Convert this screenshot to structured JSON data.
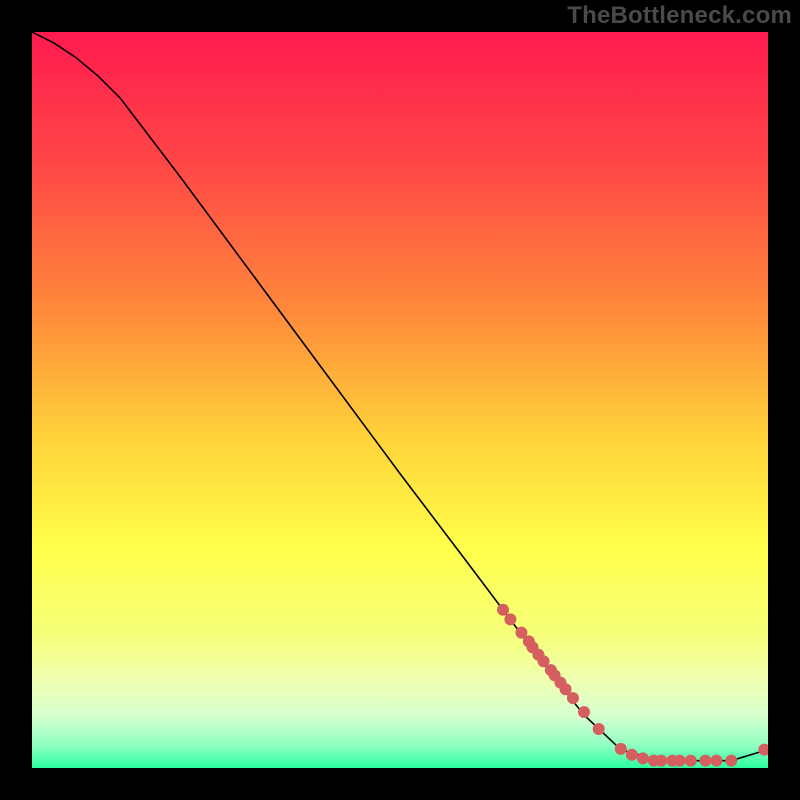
{
  "watermark": "TheBottleneck.com",
  "chart_data": {
    "type": "line",
    "title": "",
    "xlabel": "",
    "ylabel": "",
    "xlim": [
      0,
      100
    ],
    "ylim": [
      0,
      100
    ],
    "grid": false,
    "legend": false,
    "gradient_stops": [
      {
        "pos": 0.0,
        "color": "#ff1a4f"
      },
      {
        "pos": 0.18,
        "color": "#ff4747"
      },
      {
        "pos": 0.38,
        "color": "#ff8a3a"
      },
      {
        "pos": 0.55,
        "color": "#ffd23a"
      },
      {
        "pos": 0.7,
        "color": "#ffff4a"
      },
      {
        "pos": 0.82,
        "color": "#f6ff7a"
      },
      {
        "pos": 0.88,
        "color": "#efffb0"
      },
      {
        "pos": 0.93,
        "color": "#d6ffd0"
      },
      {
        "pos": 0.97,
        "color": "#8dffc0"
      },
      {
        "pos": 1.0,
        "color": "#2bff9f"
      }
    ],
    "series": [
      {
        "name": "curve",
        "type": "line",
        "color": "#000000",
        "x": [
          0,
          3,
          6,
          9,
          12,
          20,
          30,
          40,
          50,
          60,
          70,
          75,
          80,
          85,
          90,
          95,
          100
        ],
        "y": [
          100,
          98.5,
          96.5,
          94,
          91,
          80.5,
          67,
          53.5,
          40,
          26.8,
          13.5,
          7.2,
          2.5,
          1,
          1,
          1,
          2.5
        ]
      },
      {
        "name": "markers",
        "type": "scatter",
        "color": "#d55f5f",
        "radius": 6,
        "x": [
          64,
          65,
          66.5,
          67.5,
          68,
          68.8,
          69.5,
          70.5,
          71,
          71.8,
          72.5,
          73.5,
          75,
          77,
          80,
          81.5,
          83,
          84.5,
          85.5,
          87,
          88,
          89.5,
          91.5,
          93,
          95,
          99.5
        ],
        "y": [
          21.5,
          20.2,
          18.4,
          17.2,
          16.4,
          15.4,
          14.5,
          13.3,
          12.6,
          11.6,
          10.7,
          9.5,
          7.6,
          5.3,
          2.6,
          1.8,
          1.3,
          1.0,
          1.0,
          1.0,
          1.0,
          1.0,
          1.0,
          1.0,
          1.0,
          2.5
        ]
      }
    ]
  }
}
